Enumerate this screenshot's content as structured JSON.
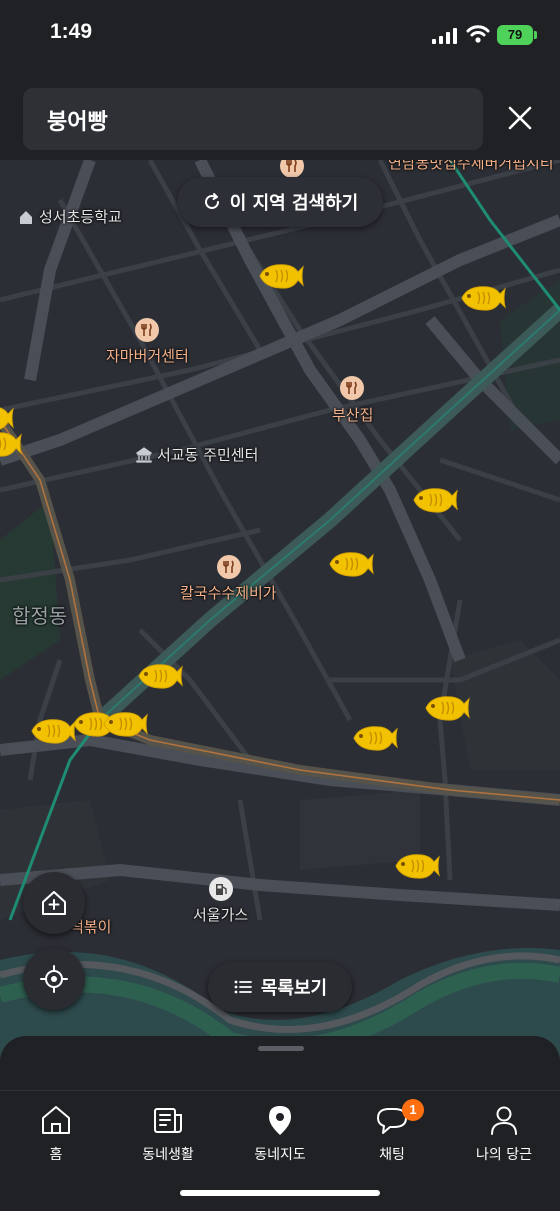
{
  "status_bar": {
    "time": "1:49",
    "battery": "79"
  },
  "search": {
    "query": "붕어빵"
  },
  "map": {
    "search_area_button": "이 지역 검색하기",
    "list_button": "목록보기",
    "places": {
      "school": "성서초등학교",
      "burger": "자마버거센터",
      "busanjip": "부산집",
      "community_center": "서교동 주민센터",
      "kalguksu": "칼국수수제비가",
      "district": "합정동",
      "gas_station": "서울가스",
      "tteokbokki_partial": "떡볶이",
      "top_partial": "연남동맛집수제버거펍시티"
    }
  },
  "tab_bar": {
    "items": [
      {
        "label": "홈"
      },
      {
        "label": "동네생활"
      },
      {
        "label": "동네지도"
      },
      {
        "label": "채팅",
        "badge": "1"
      },
      {
        "label": "나의 당근"
      }
    ]
  },
  "colors": {
    "accent": "#ff6f0f",
    "fish": "#f2c200",
    "background": "#1f2125"
  }
}
